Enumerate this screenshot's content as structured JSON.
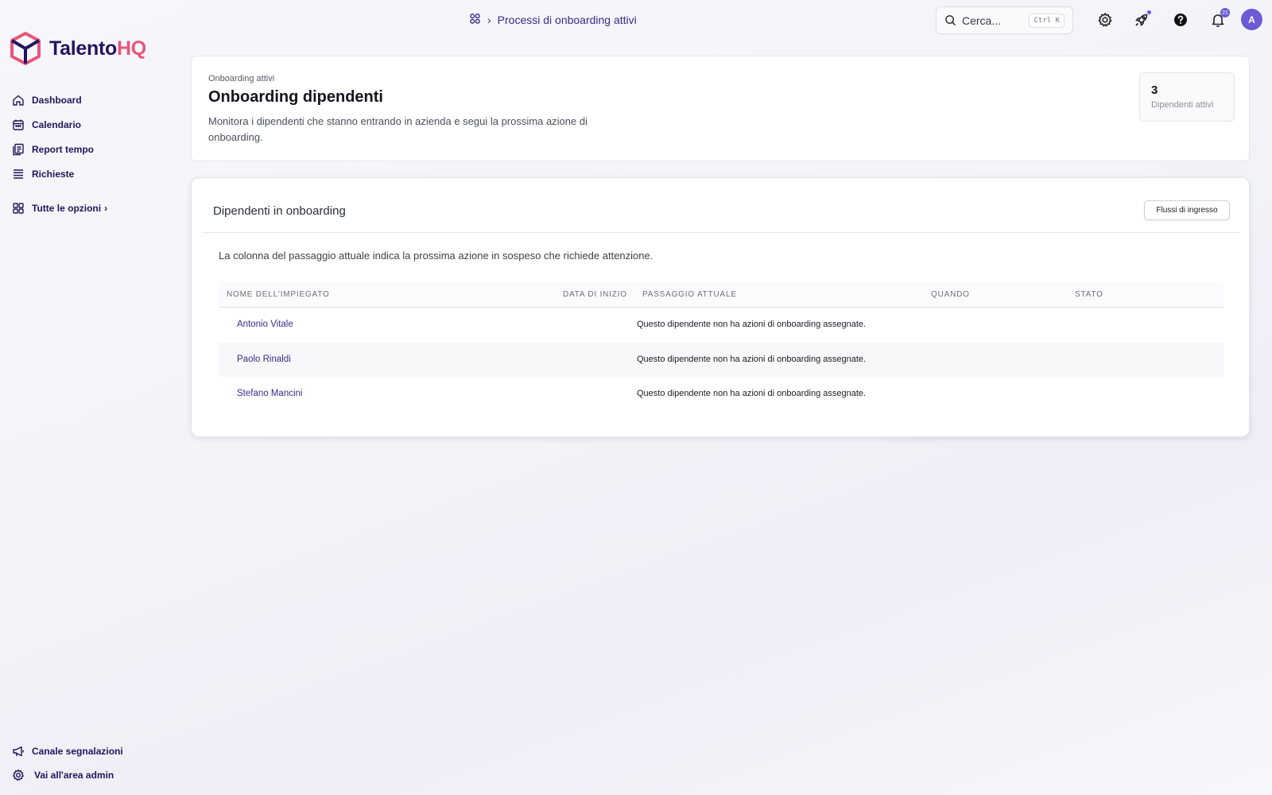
{
  "brand": {
    "name_part1": "Talento",
    "name_part2": "HQ",
    "color_primary": "#24135f",
    "color_accent": "#e8557a"
  },
  "sidebar": {
    "items": [
      {
        "label": "Dashboard",
        "icon": "home-icon"
      },
      {
        "label": "Calendario",
        "icon": "calendar-icon"
      },
      {
        "label": "Report tempo",
        "icon": "report-icon"
      },
      {
        "label": "Richieste",
        "icon": "list-icon"
      }
    ],
    "all_options": {
      "label": "Tutte le opzioni",
      "icon": "grid-icon"
    },
    "bottom": [
      {
        "label": "Canale segnalazioni",
        "icon": "megaphone-icon"
      },
      {
        "label": "Vai all'area admin",
        "icon": "gear-icon"
      }
    ]
  },
  "topbar": {
    "breadcrumb": {
      "current": "Processi di onboarding attivi"
    },
    "search": {
      "placeholder": "Cerca...",
      "shortcut": "Ctrl K"
    },
    "notifications_count": "21",
    "avatar_initial": "A",
    "accent": "#6b5bd6"
  },
  "header": {
    "eyebrow": "Onboarding attivi",
    "title": "Onboarding dipendenti",
    "description": "Monitora i dipendenti che stanno entrando in azienda e segui la prossima azione di onboarding.",
    "stat": {
      "value": "3",
      "label": "Dipendenti attivi"
    }
  },
  "list": {
    "title": "Dipendenti in onboarding",
    "button_label": "Flussi di ingresso",
    "note": "La colonna del passaggio attuale indica la prossima azione in sospeso che richiede attenzione.",
    "columns": [
      "Nome dell'impiegato",
      "Data di inizio",
      "Passaggio attuale",
      "Quando",
      "Stato"
    ],
    "rows": [
      {
        "name": "Antonio Vitale",
        "start": "",
        "step": "Questo dipendente non ha azioni di onboarding assegnate.",
        "when": "",
        "status": ""
      },
      {
        "name": "Paolo Rinaldi",
        "start": "",
        "step": "Questo dipendente non ha azioni di onboarding assegnate.",
        "when": "",
        "status": ""
      },
      {
        "name": "Stefano Mancini",
        "start": "",
        "step": "Questo dipendente non ha azioni di onboarding assegnate.",
        "when": "",
        "status": ""
      }
    ]
  }
}
